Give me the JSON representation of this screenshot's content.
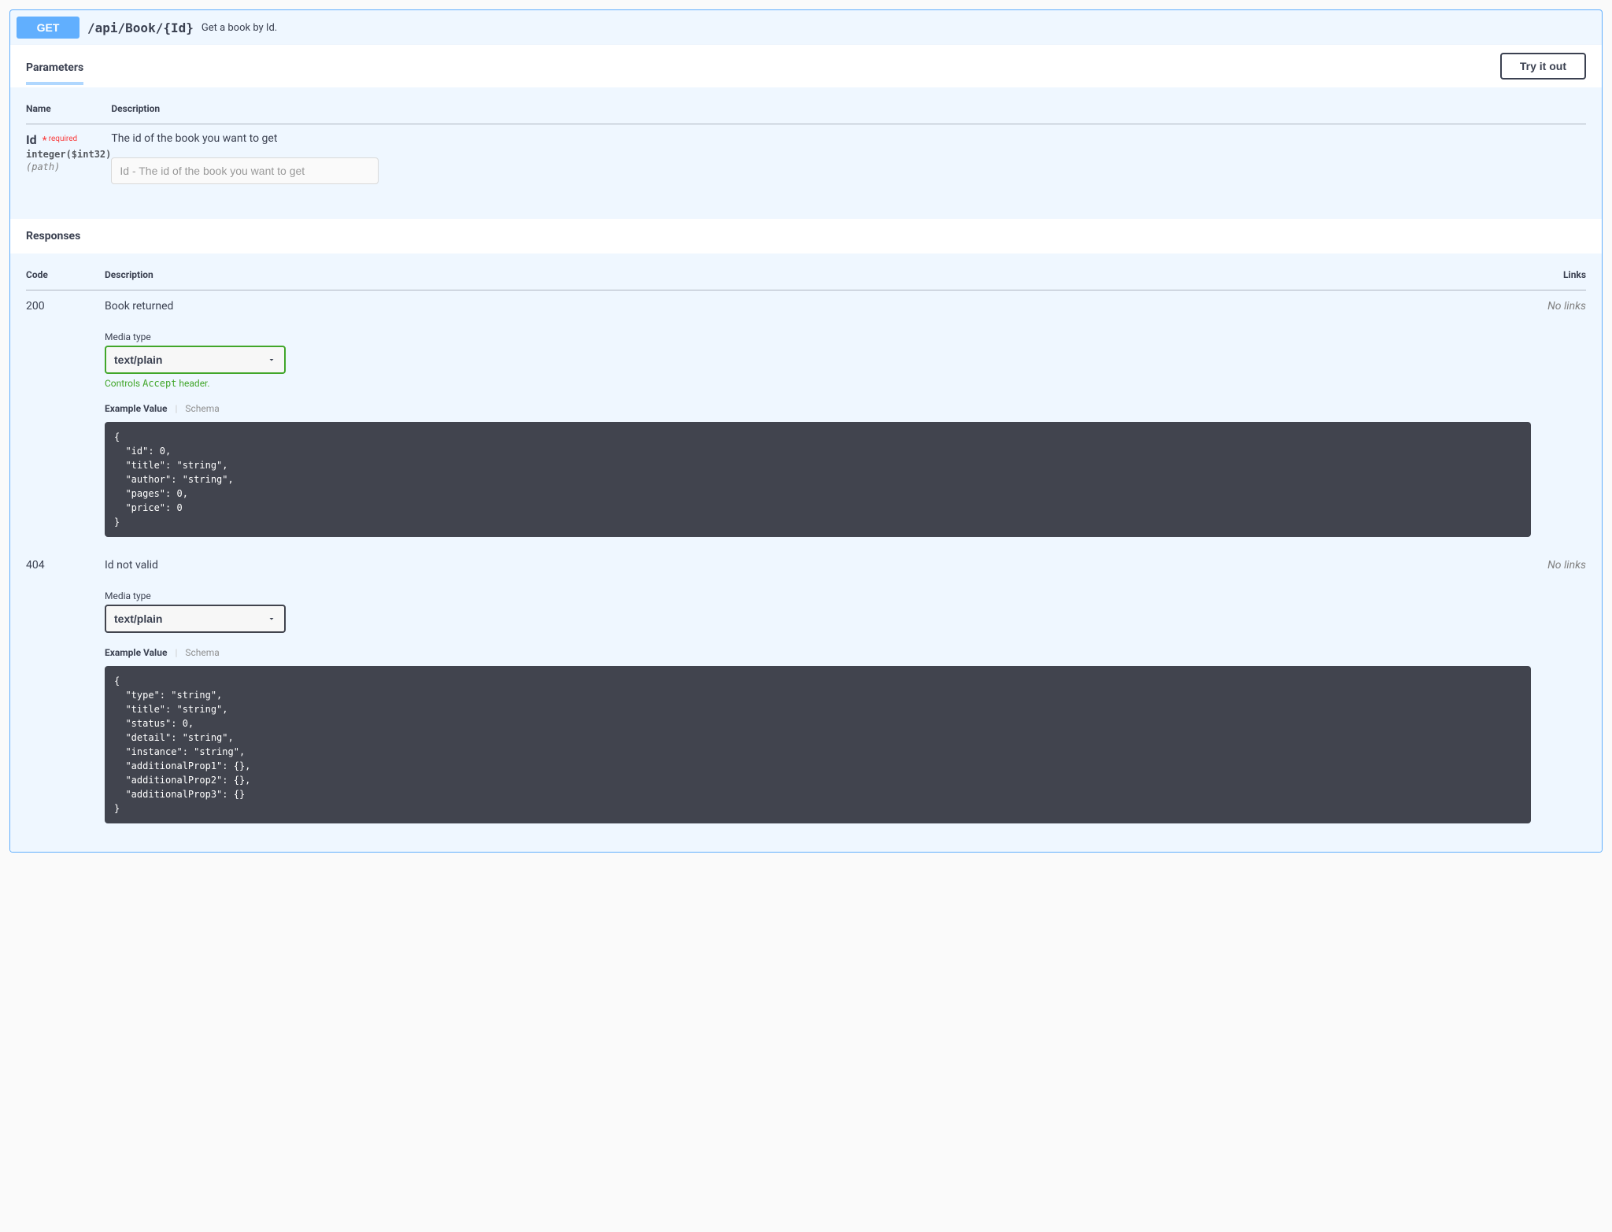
{
  "operation": {
    "method": "GET",
    "path": "/api/Book/{Id}",
    "summary": "Get a book by Id."
  },
  "sections": {
    "parameters_title": "Parameters",
    "responses_title": "Responses",
    "try_it_out": "Try it out"
  },
  "params": {
    "headers": {
      "name": "Name",
      "description": "Description"
    },
    "items": [
      {
        "name": "Id",
        "required_label": "required",
        "type": "integer",
        "format": "($int32)",
        "in": "(path)",
        "description": "The id of the book you want to get",
        "placeholder": "Id - The id of the book you want to get"
      }
    ]
  },
  "responses": {
    "headers": {
      "code": "Code",
      "description": "Description",
      "links": "Links"
    },
    "media_type_label": "Media type",
    "accept_hint_prefix": "Controls ",
    "accept_hint_code": "Accept",
    "accept_hint_suffix": " header.",
    "example_value_label": "Example Value",
    "schema_label": "Schema",
    "no_links": "No links",
    "items": [
      {
        "code": "200",
        "description": "Book returned",
        "media_type": "text/plain",
        "show_accept_hint": true,
        "example": "{\n  \"id\": 0,\n  \"title\": \"string\",\n  \"author\": \"string\",\n  \"pages\": 0,\n  \"price\": 0\n}"
      },
      {
        "code": "404",
        "description": "Id not valid",
        "media_type": "text/plain",
        "show_accept_hint": false,
        "example": "{\n  \"type\": \"string\",\n  \"title\": \"string\",\n  \"status\": 0,\n  \"detail\": \"string\",\n  \"instance\": \"string\",\n  \"additionalProp1\": {},\n  \"additionalProp2\": {},\n  \"additionalProp3\": {}\n}"
      }
    ]
  }
}
